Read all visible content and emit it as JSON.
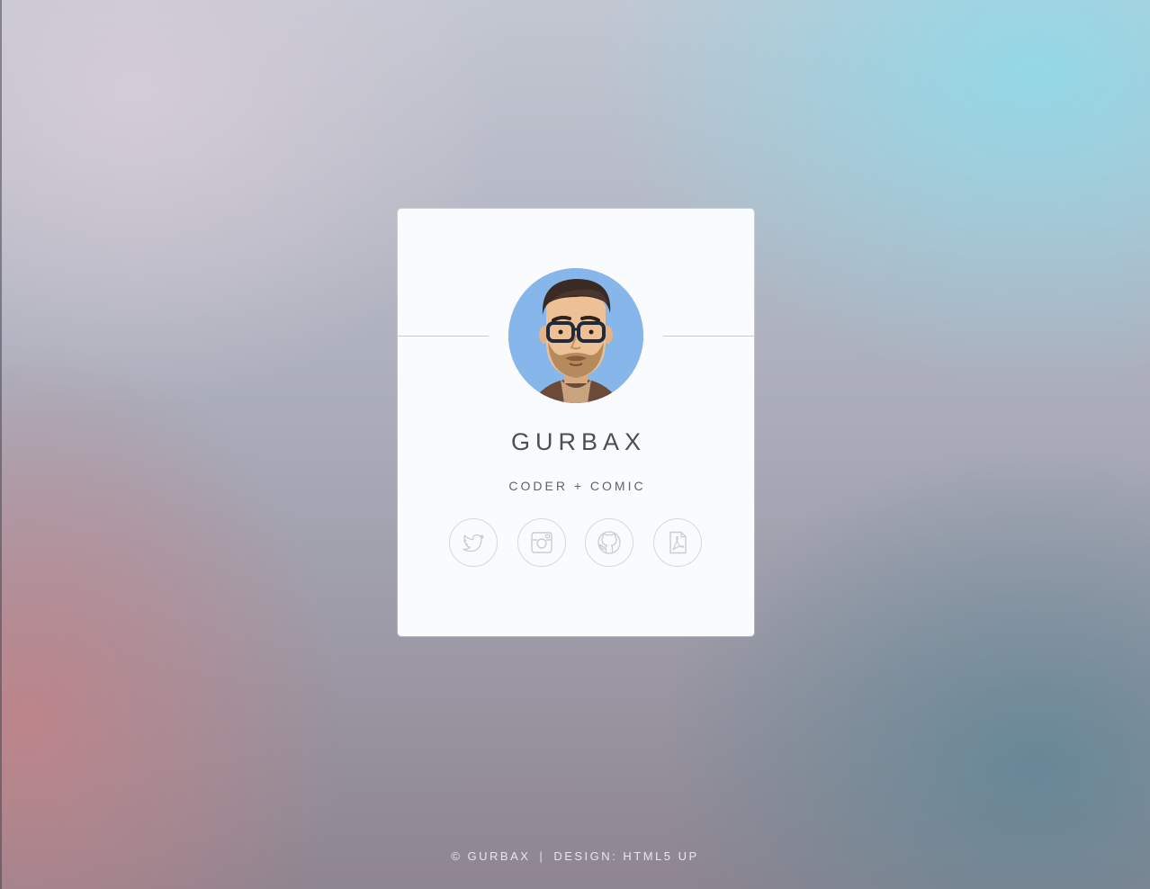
{
  "profile": {
    "name": "GURBAX",
    "tagline": "CODER + COMIC",
    "avatar_icon": "avatar-illustration",
    "avatar_bg": "#86b6ea"
  },
  "social": [
    {
      "name": "twitter",
      "icon": "twitter-icon"
    },
    {
      "name": "instagram",
      "icon": "instagram-icon"
    },
    {
      "name": "github",
      "icon": "github-icon"
    },
    {
      "name": "resume",
      "icon": "pdf-icon"
    }
  ],
  "footer": {
    "copyright": "© GURBAX",
    "separator": "|",
    "credit": "DESIGN: HTML5 UP"
  },
  "colors": {
    "card_bg": "#fafbfc",
    "icon_stroke": "#c9ccd1",
    "text": "#4a4f57"
  }
}
